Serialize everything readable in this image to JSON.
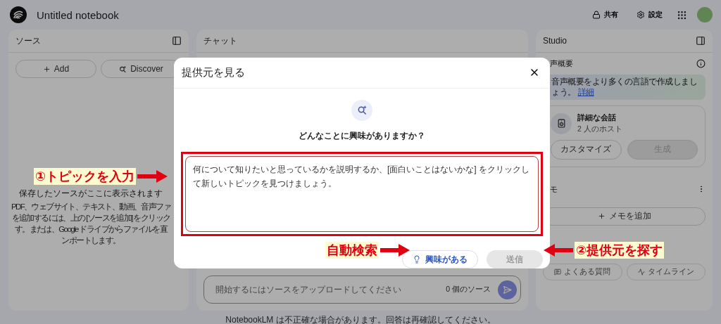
{
  "app": {
    "title": "Untitled notebook",
    "header_buttons": [
      {
        "label": "共有",
        "kind": "share"
      },
      {
        "label": "設定",
        "kind": "settings"
      }
    ]
  },
  "sources_panel": {
    "title": "ソース",
    "buttons": [
      {
        "label": "Add",
        "kind": "add"
      },
      {
        "label": "Discover",
        "kind": "discover"
      }
    ],
    "empty_title": "保存したソースがここに表示されます",
    "empty_lines": [
      "PDF、ウェブサイト、テキスト、動画、音声ファ",
      "を追加するには、上の [ソースを追加] をクリック",
      "す。または、Google ドライブからファイルを直",
      "ンポートします。"
    ]
  },
  "chat_panel": {
    "title": "チャット",
    "input": {
      "placeholder": "開始するにはソースをアップロードしてください"
    },
    "source_count": "0 個のソース"
  },
  "studio_panel": {
    "title": "Studio",
    "audio_heading": "声概要",
    "banner": {
      "text": "音声概要をより多くの言語で作成しましょう。",
      "link": "詳細"
    },
    "audio_card": {
      "title": "詳細な会話",
      "subtitle": "2 人のホスト",
      "buttons": [
        {
          "label": "カスタマイズ",
          "disabled": false
        },
        {
          "label": "生成",
          "disabled": true
        }
      ]
    },
    "notes_heading": "モ",
    "add_note": "メモを追加",
    "note_tools": [
      {
        "label": "よくある質問",
        "kind": "faq"
      },
      {
        "label": "タイムライン",
        "kind": "timeline"
      }
    ]
  },
  "footer": "NotebookLM は不正確な場合があります。回答は再確認してください。",
  "dialog": {
    "title": "提供元を見る",
    "question": "どんなことに興味がありますか？",
    "textarea": {
      "placeholder": "何について知りたいと思っているかを説明するか、[面白いことはないかな] をクリックして新しいトピックを見つけましょう。"
    },
    "buttons": [
      {
        "label": "興味がある",
        "kind": "suggest",
        "disabled": false
      },
      {
        "label": "送信",
        "kind": "submit",
        "disabled": true
      }
    ]
  },
  "annotations": [
    {
      "label": "①トピックを入力",
      "kind": "right_arrow"
    },
    {
      "label": "自動検索",
      "kind": "right_arrow"
    },
    {
      "label": "②提供元を探す",
      "kind": "left_arrow"
    }
  ]
}
